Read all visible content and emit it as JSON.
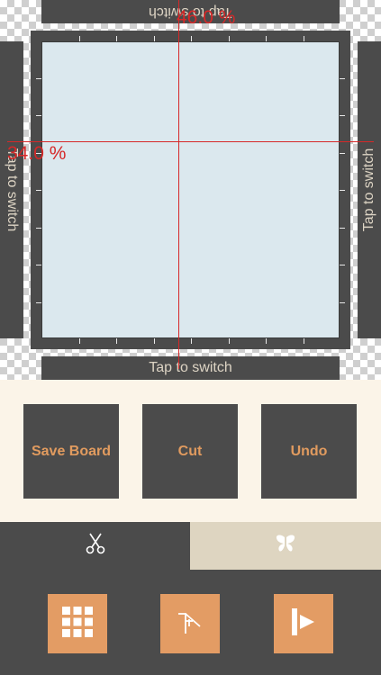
{
  "switch_bars": {
    "top": "Tap to switch",
    "bottom": "Tap to switch",
    "left": "Tap to switch",
    "right": "Tap to switch"
  },
  "guides": {
    "vertical_percent": "46.0 %",
    "horizontal_percent": "34.0 %",
    "color": "#d62828"
  },
  "actions": {
    "save_board": "Save Board",
    "cut": "Cut",
    "undo": "Undo"
  },
  "tabs": {
    "cut_icon": "scissors-icon",
    "fold_icon": "butterfly-icon"
  },
  "toolbar": {
    "grid_icon": "grid-icon",
    "corner_icon": "corner-cut-icon",
    "next_icon": "play-next-icon"
  },
  "colors": {
    "accent": "#e39c64",
    "dark": "#4b4b4b",
    "board": "#dbe8ee",
    "cream": "#fbf4e8"
  }
}
